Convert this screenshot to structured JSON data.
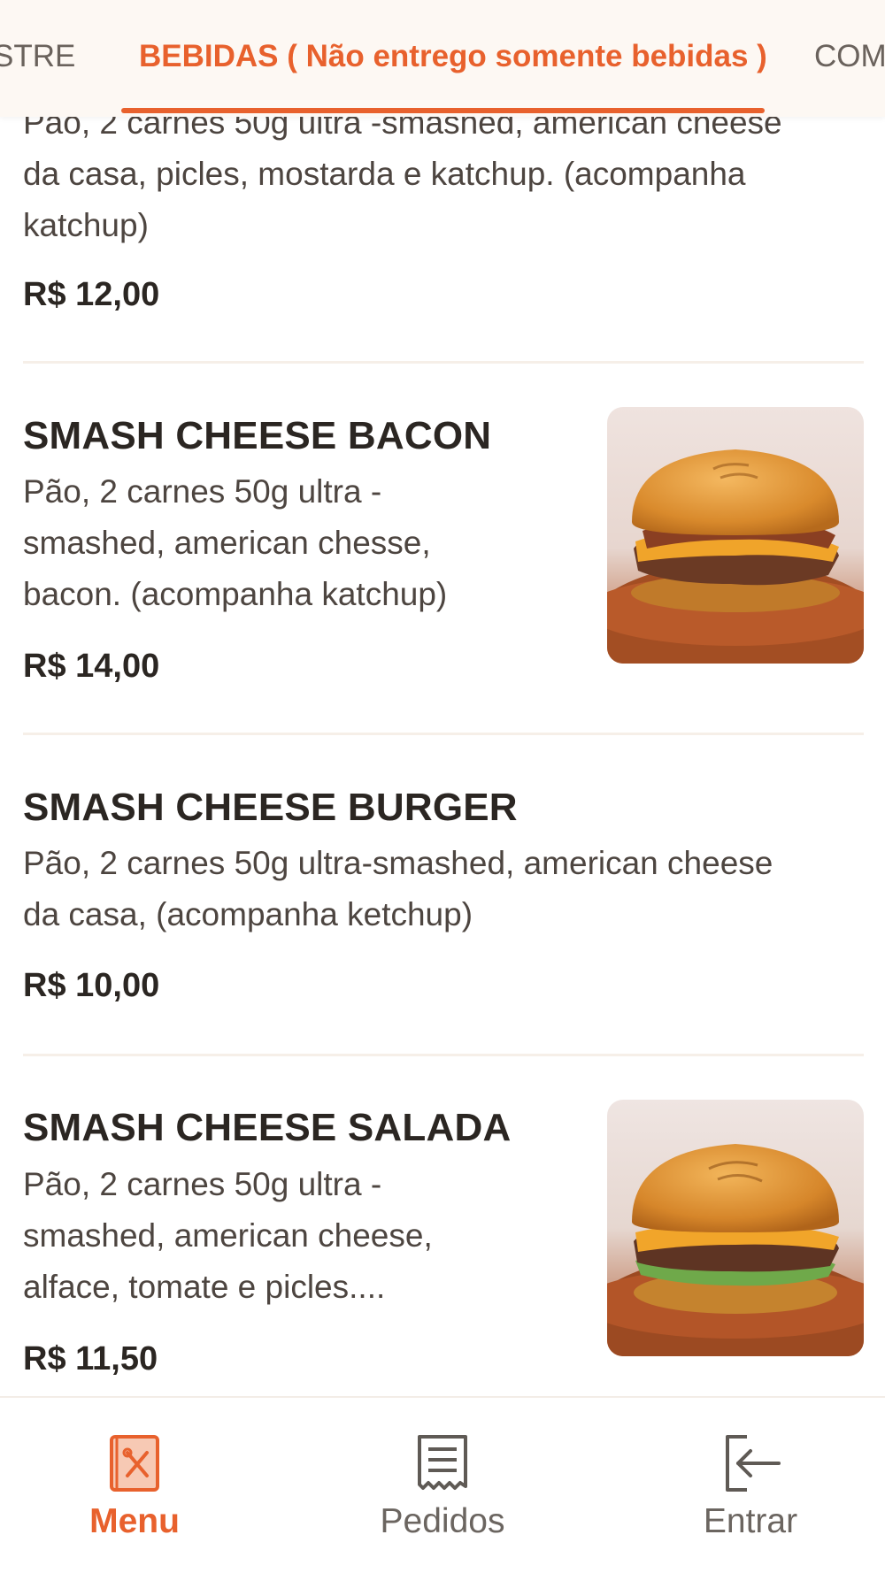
{
  "tabs": {
    "prev_label": "STRE",
    "active_label": "BEBIDAS ( Não entrego somente bebidas )",
    "next_label": "COM"
  },
  "items": [
    {
      "description_partial_top": "Pão, 2 carnes 50g ultra -smashed, american cheese",
      "description_lines": [
        "da casa, picles, mostarda e katchup. (acompanha",
        "katchup)"
      ],
      "price": "R$ 12,00"
    },
    {
      "name": "SMASH CHEESE BACON",
      "description_lines": [
        "Pão, 2 carnes 50g ultra -",
        "smashed, american chesse,",
        "bacon. (acompanha katchup)"
      ],
      "price": "R$ 14,00",
      "image": "burger-bacon-photo"
    },
    {
      "name": "SMASH CHEESE BURGER",
      "description_lines": [
        "Pão, 2 carnes 50g ultra-smashed, american cheese",
        "da casa, (acompanha ketchup)"
      ],
      "price": "R$ 10,00"
    },
    {
      "name": "SMASH CHEESE SALADA",
      "description_lines": [
        "Pão, 2 carnes 50g ultra -",
        "smashed, american cheese,",
        "alface, tomate e picles...."
      ],
      "price": "R$ 11,50",
      "image": "burger-salada-photo"
    }
  ],
  "bottom_nav": {
    "menu": {
      "label": "Menu",
      "icon": "menu-book-icon"
    },
    "orders": {
      "label": "Pedidos",
      "icon": "receipt-icon"
    },
    "login": {
      "label": "Entrar",
      "icon": "login-icon"
    }
  },
  "colors": {
    "accent": "#e8612d",
    "text": "#2b2622",
    "muted": "#6b6560",
    "tab_bar_bg": "#fdf8f3"
  }
}
